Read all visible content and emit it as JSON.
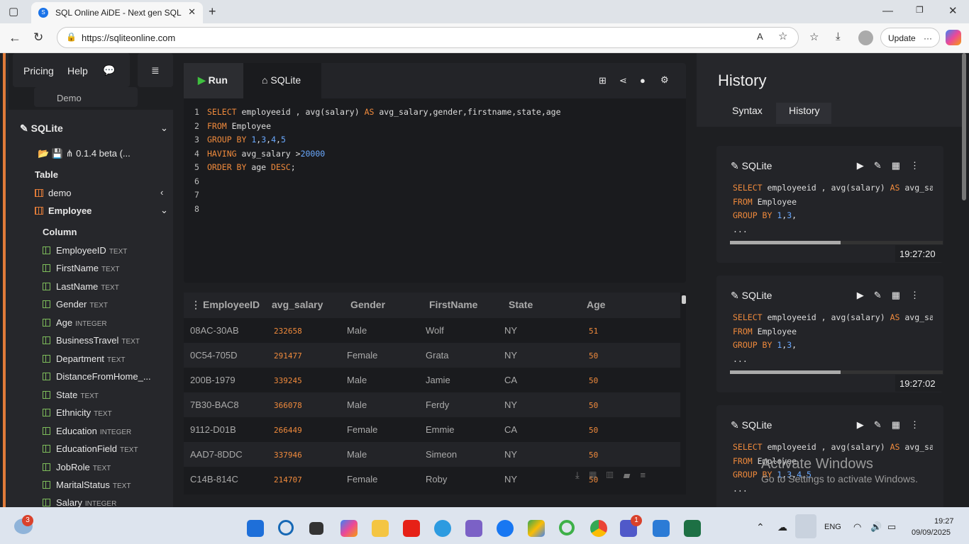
{
  "browser": {
    "tab_title": "SQL Online AiDE - Next gen SQL Editor",
    "url": "https://sqliteonline.com",
    "update_label": "Update"
  },
  "topnav": {
    "pricing": "Pricing",
    "help": "Help",
    "demo": "Demo"
  },
  "sidebar": {
    "db": "SQLite",
    "version": "0.1.4 beta (...",
    "table_heading": "Table",
    "tables": [
      "demo",
      "Employee"
    ],
    "column_heading": "Column",
    "columns": [
      {
        "name": "EmployeeID",
        "type": "TEXT"
      },
      {
        "name": "FirstName",
        "type": "TEXT"
      },
      {
        "name": "LastName",
        "type": "TEXT"
      },
      {
        "name": "Gender",
        "type": "TEXT"
      },
      {
        "name": "Age",
        "type": "INTEGER"
      },
      {
        "name": "BusinessTravel",
        "type": "TEXT"
      },
      {
        "name": "Department",
        "type": "TEXT"
      },
      {
        "name": "DistanceFromHome_...",
        "type": ""
      },
      {
        "name": "State",
        "type": "TEXT"
      },
      {
        "name": "Ethnicity",
        "type": "TEXT"
      },
      {
        "name": "Education",
        "type": "INTEGER"
      },
      {
        "name": "EducationField",
        "type": "TEXT"
      },
      {
        "name": "JobRole",
        "type": "TEXT"
      },
      {
        "name": "MaritalStatus",
        "type": "TEXT"
      },
      {
        "name": "Salary",
        "type": "INTEGER"
      }
    ]
  },
  "editor": {
    "run_label": "Run",
    "tab_label": "SQLite",
    "lines": [
      "1",
      "2",
      "3",
      "4",
      "5",
      "6",
      "7",
      "8"
    ]
  },
  "results": {
    "headers": [
      "EmployeeID",
      "avg_salary",
      "Gender",
      "FirstName",
      "State",
      "Age"
    ],
    "rows": [
      [
        "08AC-30AB",
        "232658",
        "Male",
        "Wolf",
        "NY",
        "51"
      ],
      [
        "0C54-705D",
        "291477",
        "Female",
        "Grata",
        "NY",
        "50"
      ],
      [
        "200B-1979",
        "339245",
        "Male",
        "Jamie",
        "CA",
        "50"
      ],
      [
        "7B30-BAC8",
        "366078",
        "Male",
        "Ferdy",
        "NY",
        "50"
      ],
      [
        "9112-D01B",
        "266449",
        "Female",
        "Emmie",
        "CA",
        "50"
      ],
      [
        "AAD7-8DDC",
        "337946",
        "Male",
        "Simeon",
        "NY",
        "50"
      ],
      [
        "C14B-814C",
        "214707",
        "Female",
        "Roby",
        "NY",
        "50"
      ]
    ]
  },
  "history": {
    "title": "History",
    "tab_syntax": "Syntax",
    "tab_history": "History",
    "cards": [
      {
        "db": "SQLite",
        "time": "19:27:20",
        "more": "..."
      },
      {
        "db": "SQLite",
        "time": "19:27:02",
        "more": "..."
      },
      {
        "db": "SQLite",
        "time": "",
        "more": "..."
      }
    ]
  },
  "watermark": {
    "line1": "Activate Windows",
    "line2": "Go to Settings to activate Windows."
  },
  "taskbar": {
    "badge_weather": "3",
    "badge_teams": "1",
    "lang": "ENG",
    "time": "19:27",
    "date": "09/09/2025"
  }
}
